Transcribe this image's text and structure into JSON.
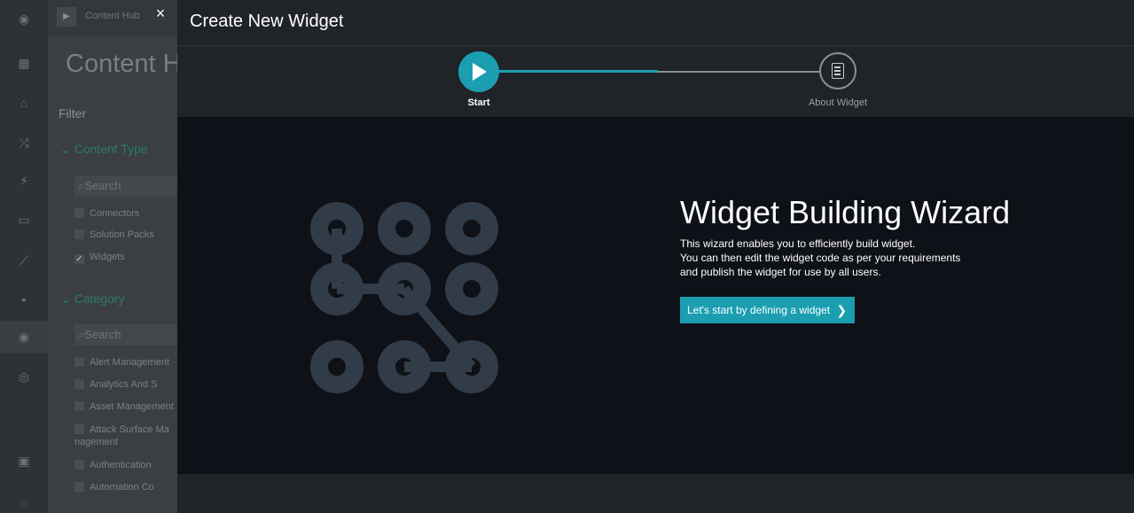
{
  "background_app": {
    "breadcrumb": "Content Hub",
    "page_title": "Content Hub",
    "filter_label": "Filter",
    "content_type_header": "Content Type",
    "content_type_search_placeholder": "Search",
    "content_types": [
      {
        "label": "Connectors",
        "checked": false
      },
      {
        "label": "Solution Packs",
        "checked": false
      },
      {
        "label": "Widgets",
        "checked": true
      }
    ],
    "category_header": "Category",
    "category_search_placeholder": "Search",
    "categories": [
      "Alert Management",
      "Analytics And S",
      "Asset Management",
      "Attack Surface Management",
      "Authentication",
      "Automation Co"
    ]
  },
  "modal": {
    "close_label": "×",
    "title": "Create New Widget",
    "steps": [
      {
        "label": "Start",
        "state": "active",
        "icon": "play-icon"
      },
      {
        "label": "About Widget",
        "state": "pending",
        "icon": "document-icon"
      }
    ],
    "progress_fraction": 0.52,
    "wizard_title": "Widget Building Wizard",
    "wizard_desc_lines": [
      "This wizard enables you to efficiently build widget.",
      "You can then edit the widget code as per your requirements",
      "and publish the widget for use by all users."
    ],
    "start_button_label": "Let's start by defining a widget",
    "start_button_icon": "chevron-right-icon",
    "graphic_icon": "pattern-lock-icon"
  },
  "colors": {
    "accent": "#1b9fb0",
    "modal_bg": "#202328",
    "body_bg": "#0e1117",
    "graphic": "#323b48"
  }
}
